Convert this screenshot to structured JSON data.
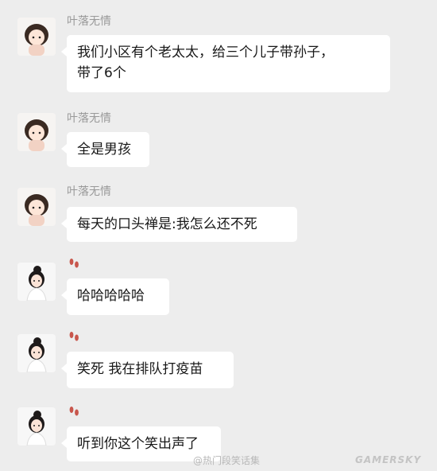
{
  "messages": [
    {
      "sender": "叶落无情",
      "text": "我们小区有个老太太，给三个儿子带孙子，\n带了6个",
      "avatar": "cartoon-girl-avatar"
    },
    {
      "sender": "叶落无情",
      "text": "全是男孩",
      "avatar": "cartoon-girl-avatar"
    },
    {
      "sender": "叶落无情",
      "text": "每天的口头禅是:我怎么还不死",
      "avatar": "cartoon-girl-avatar"
    },
    {
      "sender": "",
      "text": "哈哈哈哈哈",
      "avatar": "girl-photo-avatar",
      "name_icon": "footprints-icon"
    },
    {
      "sender": "",
      "text": "笑死 我在排队打疫苗",
      "avatar": "girl-photo-avatar",
      "name_icon": "footprints-icon"
    },
    {
      "sender": "",
      "text": "听到你这个笑出声了",
      "avatar": "girl-photo-avatar",
      "name_icon": "footprints-icon"
    }
  ],
  "watermark": {
    "text": "@热门段笑话集",
    "logo": "GAMERSKY"
  },
  "colors": {
    "background": "#ededed",
    "bubble": "#ffffff",
    "sender_name": "#9a9a9a",
    "footprints": "#c8564c"
  }
}
